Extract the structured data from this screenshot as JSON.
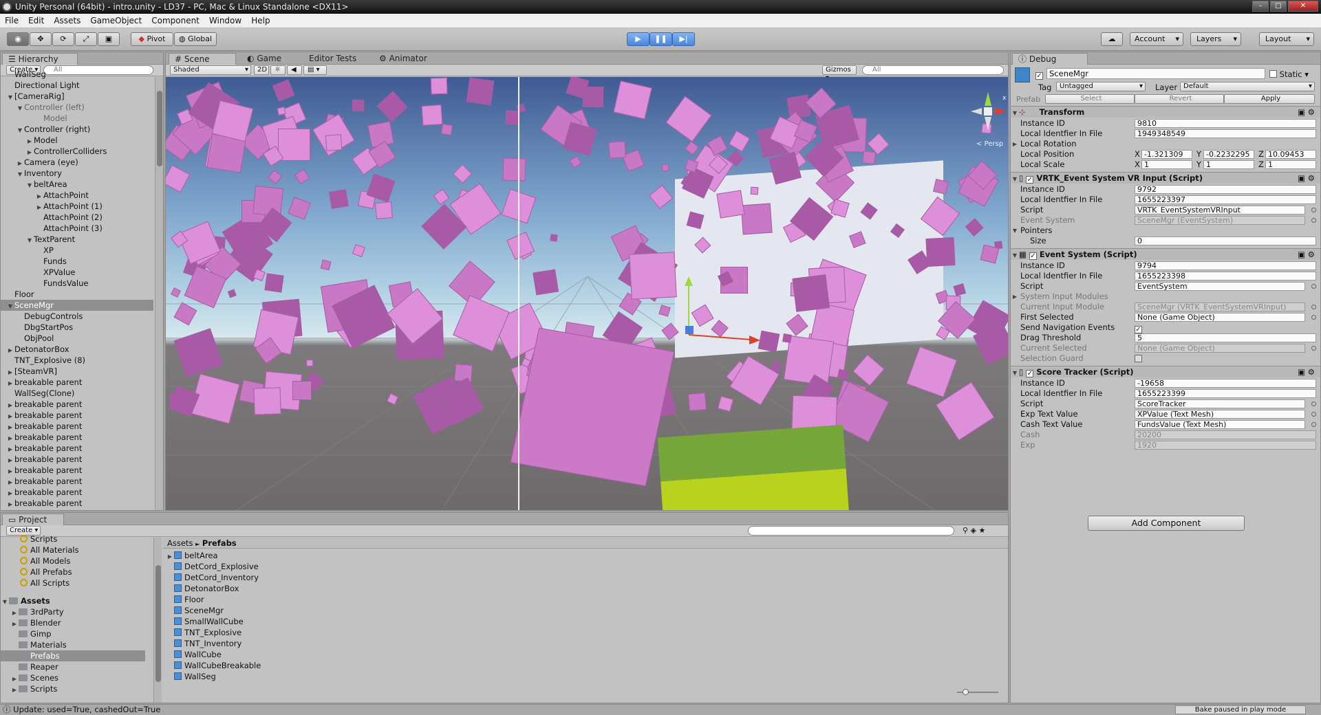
{
  "window": {
    "title": "Unity Personal (64bit) - intro.unity - LD37 - PC, Mac & Linux Standalone <DX11>"
  },
  "menu": [
    "File",
    "Edit",
    "Assets",
    "GameObject",
    "Component",
    "Window",
    "Help"
  ],
  "toolbar": {
    "pivot_label": "Pivot",
    "global_label": "Global",
    "account_label": "Account",
    "layers_label": "Layers",
    "layout_label": "Layout",
    "transport": [
      "play",
      "pause",
      "step"
    ]
  },
  "hierarchy": {
    "tab": "Hierarchy",
    "create_label": "Create",
    "search_placeholder": "All",
    "items": [
      {
        "label": "WallSeg",
        "indent": 1,
        "arrow": ""
      },
      {
        "label": "Directional Light",
        "indent": 1,
        "arrow": ""
      },
      {
        "label": "[CameraRig]",
        "indent": 1,
        "arrow": "open"
      },
      {
        "label": "Controller (left)",
        "indent": 2,
        "arrow": "open",
        "grey": true
      },
      {
        "label": "Model",
        "indent": 4,
        "arrow": "",
        "grey": true
      },
      {
        "label": "Controller (right)",
        "indent": 2,
        "arrow": "open"
      },
      {
        "label": "Model",
        "indent": 3,
        "arrow": "closed"
      },
      {
        "label": "ControllerColliders",
        "indent": 3,
        "arrow": "closed"
      },
      {
        "label": "Camera (eye)",
        "indent": 2,
        "arrow": "closed"
      },
      {
        "label": "Inventory",
        "indent": 2,
        "arrow": "open"
      },
      {
        "label": "beltArea",
        "indent": 3,
        "arrow": "open"
      },
      {
        "label": "AttachPoint",
        "indent": 4,
        "arrow": "closed"
      },
      {
        "label": "AttachPoint (1)",
        "indent": 4,
        "arrow": "closed"
      },
      {
        "label": "AttachPoint (2)",
        "indent": 4,
        "arrow": ""
      },
      {
        "label": "AttachPoint (3)",
        "indent": 4,
        "arrow": ""
      },
      {
        "label": "TextParent",
        "indent": 3,
        "arrow": "open"
      },
      {
        "label": "XP",
        "indent": 4,
        "arrow": ""
      },
      {
        "label": "Funds",
        "indent": 4,
        "arrow": ""
      },
      {
        "label": "XPValue",
        "indent": 4,
        "arrow": ""
      },
      {
        "label": "FundsValue",
        "indent": 4,
        "arrow": ""
      },
      {
        "label": "Floor",
        "indent": 1,
        "arrow": ""
      },
      {
        "label": "SceneMgr",
        "indent": 1,
        "arrow": "open",
        "selected": true
      },
      {
        "label": "DebugControls",
        "indent": 2,
        "arrow": ""
      },
      {
        "label": "DbgStartPos",
        "indent": 2,
        "arrow": ""
      },
      {
        "label": "ObjPool",
        "indent": 2,
        "arrow": ""
      },
      {
        "label": "DetonatorBox",
        "indent": 1,
        "arrow": "closed"
      },
      {
        "label": "TNT_Explosive (8)",
        "indent": 1,
        "arrow": ""
      },
      {
        "label": "[SteamVR]",
        "indent": 1,
        "arrow": "closed"
      },
      {
        "label": "breakable parent",
        "indent": 1,
        "arrow": "closed"
      },
      {
        "label": "WallSeg(Clone)",
        "indent": 1,
        "arrow": ""
      },
      {
        "label": "breakable parent",
        "indent": 1,
        "arrow": "closed"
      },
      {
        "label": "breakable parent",
        "indent": 1,
        "arrow": "closed"
      },
      {
        "label": "breakable parent",
        "indent": 1,
        "arrow": "closed"
      },
      {
        "label": "breakable parent",
        "indent": 1,
        "arrow": "closed"
      },
      {
        "label": "breakable parent",
        "indent": 1,
        "arrow": "closed"
      },
      {
        "label": "breakable parent",
        "indent": 1,
        "arrow": "closed"
      },
      {
        "label": "breakable parent",
        "indent": 1,
        "arrow": "closed"
      },
      {
        "label": "breakable parent",
        "indent": 1,
        "arrow": "closed"
      },
      {
        "label": "breakable parent",
        "indent": 1,
        "arrow": "closed"
      },
      {
        "label": "breakable parent",
        "indent": 1,
        "arrow": "closed"
      }
    ]
  },
  "scene": {
    "tabs": [
      "Scene",
      "Game",
      "Editor Tests",
      "Animator"
    ],
    "shading": "Shaded",
    "mode_2d": "2D",
    "gizmos_label": "Gizmos",
    "search_placeholder": "All",
    "persp_label": "Persp"
  },
  "inspector": {
    "tab": "Debug",
    "object_name": "SceneMgr",
    "static_label": "Static",
    "tag_label": "Tag",
    "tag_value": "Untagged",
    "layer_label": "Layer",
    "layer_value": "Default",
    "prefab_label": "Prefab",
    "prefab_buttons": [
      "Select",
      "Revert",
      "Apply"
    ],
    "transform": {
      "title": "Transform",
      "instance_id_label": "Instance ID",
      "instance_id": "9810",
      "local_id_label": "Local Identfier In File",
      "local_id": "1949348549",
      "local_rotation_label": "Local Rotation",
      "local_position_label": "Local Position",
      "pos_x": "-1.321309",
      "pos_y": "-0.2232295",
      "pos_z": "10.09453",
      "local_scale_label": "Local Scale",
      "scale_x": "1",
      "scale_y": "1",
      "scale_z": "1",
      "axis_x": "X",
      "axis_y": "Y",
      "axis_z": "Z"
    },
    "vrtk": {
      "title": "VRTK_Event System VR Input (Script)",
      "instance_id": "9792",
      "local_id": "1655223397",
      "script_label": "Script",
      "script": "VRTK_EventSystemVRInput",
      "event_system_label": "Event System",
      "event_system": "SceneMgr (EventSystem)",
      "pointers_label": "Pointers",
      "size_label": "Size",
      "size": "0"
    },
    "eventsystem": {
      "title": "Event System (Script)",
      "instance_id": "9794",
      "local_id": "1655223398",
      "script": "EventSystem",
      "modules_label": "System Input Modules",
      "current_module_label": "Current Input Module",
      "current_module": "SceneMgr (VRTK_EventSystemVRInput)",
      "first_selected_label": "First Selected",
      "first_selected": "None (Game Object)",
      "send_nav_label": "Send Navigation Events",
      "drag_threshold_label": "Drag Threshold",
      "drag_threshold": "5",
      "current_selected_label": "Current Selected",
      "current_selected": "None (Game Object)",
      "selection_guard_label": "Selection Guard"
    },
    "score": {
      "title": "Score Tracker (Script)",
      "instance_id": "-19658",
      "local_id": "1655223399",
      "script": "ScoreTracker",
      "exp_text_label": "Exp Text Value",
      "exp_text": "XPValue (Text Mesh)",
      "cash_text_label": "Cash Text Value",
      "cash_text": "FundsValue (Text Mesh)",
      "cash_label": "Cash",
      "cash": "20200",
      "exp_label": "Exp",
      "exp": "1920"
    },
    "add_component": "Add Component"
  },
  "project": {
    "tab": "Project",
    "create_label": "Create",
    "favorites": [
      "Scripts",
      "All Materials",
      "All Models",
      "All Prefabs",
      "All Scripts"
    ],
    "assets_label": "Assets",
    "folders": [
      "3rdParty",
      "Blender",
      "Gimp",
      "Materials",
      "Prefabs",
      "Reaper",
      "Scenes",
      "Scripts"
    ],
    "selected_folder": "Prefabs",
    "breadcrumb_root": "Assets",
    "breadcrumb_sep": "►",
    "breadcrumb_current": "Prefabs",
    "prefabs": [
      "beltArea",
      "DetCord_Explosive",
      "DetCord_Inventory",
      "DetonatorBox",
      "Floor",
      "SceneMgr",
      "SmallWallCube",
      "TNT_Explosive",
      "TNT_Inventory",
      "WallCube",
      "WallCubeBreakable",
      "WallSeg"
    ]
  },
  "status": {
    "message": "Update: used=True, cashedOut=True",
    "bake": "Bake paused in play mode"
  },
  "colors": {
    "cube": "#c978c6",
    "floor": "#6e6a6b",
    "sky": "#7ea5cd",
    "selection": "#8f8f8f",
    "play_blue": "#4a86d8"
  }
}
